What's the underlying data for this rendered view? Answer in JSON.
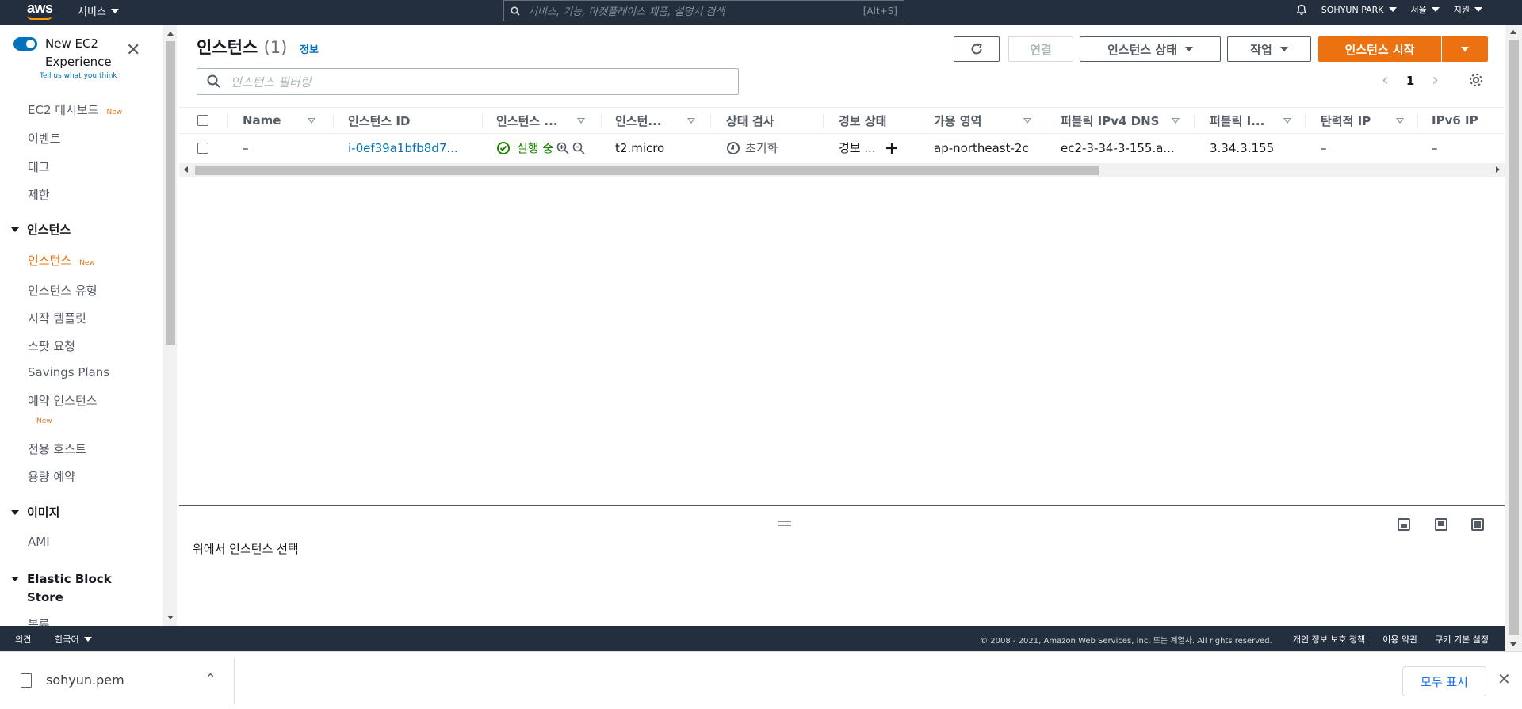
{
  "topbar": {
    "logo": "aws",
    "services_label": "서비스",
    "search_placeholder": "서비스, 기능, 마켓플레이스 제품, 설명서 검색",
    "search_shortcut": "[Alt+S]",
    "user_label": "SOHYUN PARK",
    "region_label": "서울",
    "support_label": "지원",
    "bell_icon": "bell-icon"
  },
  "sidebar": {
    "new_experience_label": "New EC2\nExperience",
    "new_experience_line1": "New EC2",
    "new_experience_line2": "Experience",
    "tell_us": "Tell us what you think",
    "new_badge": "New",
    "links": {
      "dashboard": "EC2 대시보드",
      "events": "이벤트",
      "tags": "태그",
      "limits": "제한",
      "instances": "인스턴스",
      "instance_types": "인스턴스 유형",
      "launch_templates": "시작 템플릿",
      "spot_requests": "스팟 요청",
      "savings_plans": "Savings Plans",
      "reserved_instances": "예약 인스턴스",
      "dedicated_hosts": "전용 호스트",
      "capacity_reservations": "용량 예약",
      "ami": "AMI",
      "volumes": "볼륨"
    },
    "sections": {
      "instances": "인스턴스",
      "images": "이미지",
      "ebs_line1": "Elastic Block",
      "ebs_line2": "Store"
    }
  },
  "main": {
    "title": "인스턴스",
    "count": "(1)",
    "info_link": "정보",
    "buttons": {
      "connect": "연결",
      "instance_state": "인스턴스 상태",
      "actions": "작업",
      "launch": "인스턴스 시작"
    },
    "filter_placeholder": "인스턴스 필터링",
    "page_number": "1",
    "columns": [
      "Name",
      "인스턴스 ID",
      "인스턴스 ...",
      "인스턴...",
      "상태 검사",
      "경보 상태",
      "가용 영역",
      "퍼블릭 IPv4 DNS",
      "퍼블릭 I...",
      "탄력적 IP",
      "IPv6 IP"
    ],
    "row": {
      "name": "–",
      "instance_id": "i-0ef39a1bfb8d7...",
      "state": "실행 중",
      "type": "t2.micro",
      "status_check": "초기화",
      "alarm": "경보 ...",
      "az": "ap-northeast-2c",
      "public_dns": "ec2-3-34-3-155.a...",
      "public_ip": "3.34.3.155",
      "elastic_ip": "–",
      "ipv6": "–"
    },
    "detail_prompt": "위에서 인스턴스 선택"
  },
  "footer": {
    "feedback": "의견",
    "language": "한국어",
    "copyright": "© 2008 - 2021, Amazon Web Services, Inc. 또는 계열사. All rights reserved.",
    "privacy": "개인 정보 보호 정책",
    "terms": "이용 약관",
    "cookies": "쿠키 기본 설정"
  },
  "downloads": {
    "file_name": "sohyun.pem",
    "show_all": "모두 표시"
  },
  "colors": {
    "topbar": "#232f3e",
    "accent": "#ec7211",
    "link": "#0073bb",
    "running": "#1d8102"
  }
}
